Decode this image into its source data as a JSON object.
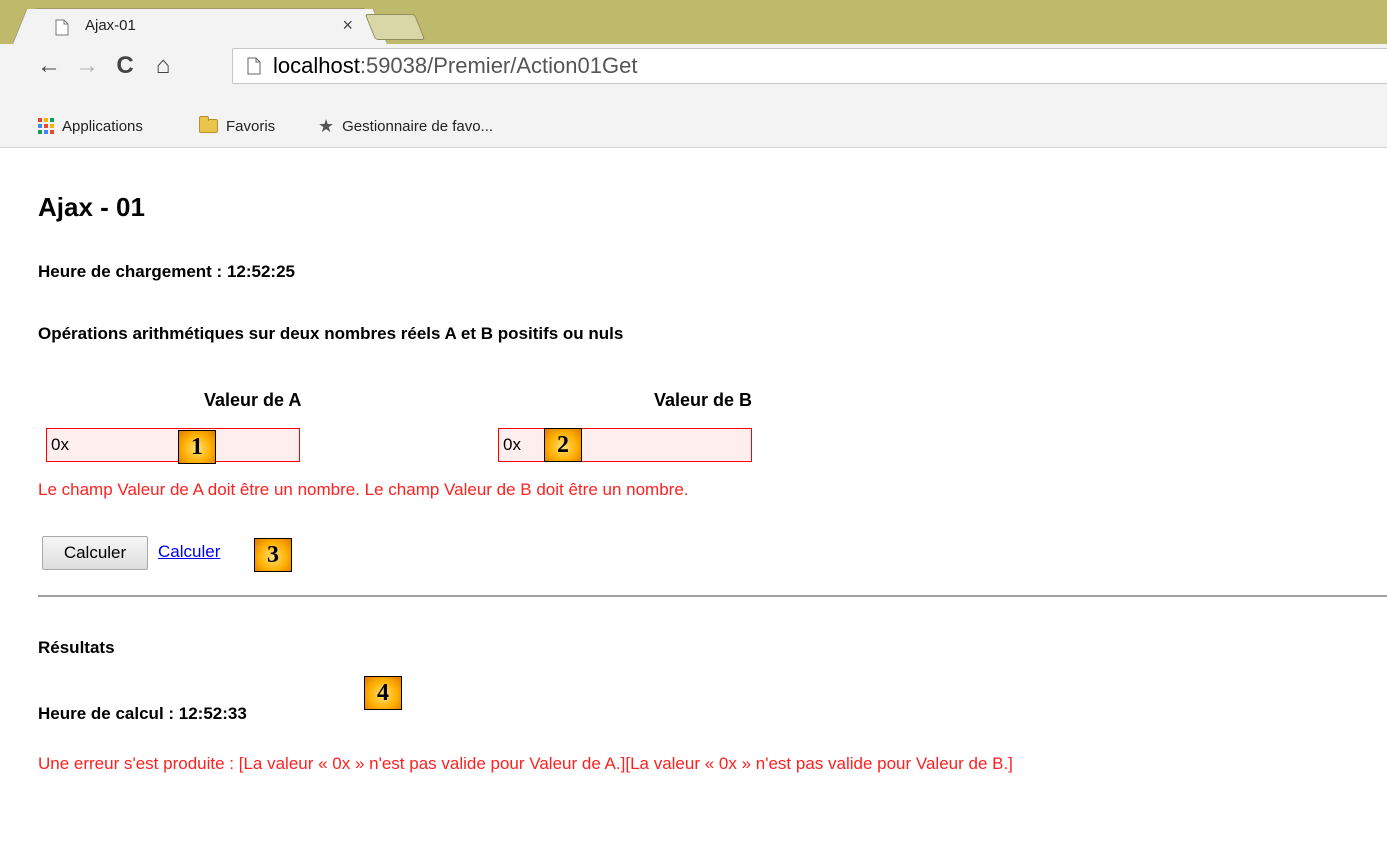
{
  "browser": {
    "tab": {
      "title": "Ajax-01",
      "close_glyph": "×"
    },
    "nav": {
      "back": "←",
      "forward": "→",
      "reload": "C",
      "home": "⌂"
    },
    "address": {
      "host": "localhost",
      "rest": ":59038/Premier/Action01Get"
    },
    "bookmarks": {
      "apps": "Applications",
      "favoris": "Favoris",
      "gestionnaire": "Gestionnaire de favo..."
    },
    "icons": [
      "page-icon",
      "apps-grid-icon",
      "folder-icon",
      "star-icon"
    ]
  },
  "page": {
    "title": "Ajax - 01",
    "load_time": "Heure de chargement : 12:52:25",
    "operations": "Opérations arithmétiques sur deux nombres réels A et B positifs ou nuls",
    "label_a": "Valeur de A",
    "label_b": "Valeur de B",
    "value_a": "0x",
    "value_b": "0x",
    "validation_message": "Le champ Valeur de A doit être un nombre. Le champ Valeur de B doit être un nombre.",
    "calc_button": "Calculer",
    "calc_link": "Calculer",
    "results_heading": "Résultats",
    "calc_time": "Heure de calcul : 12:52:33",
    "error_message": "Une erreur s'est produite : [La valeur « 0x » n'est pas valide pour Valeur de A.][La valeur « 0x » n'est pas valide pour Valeur de B.]"
  },
  "markers": {
    "m1": "1",
    "m2": "2",
    "m3": "3",
    "m4": "4"
  },
  "colors": {
    "tabstrip": "#bfb96b",
    "error": "#ff2020",
    "field_bg": "#ffeeee",
    "field_border": "#ff0000",
    "link": "#0000ee",
    "marker": "#ffb000"
  }
}
